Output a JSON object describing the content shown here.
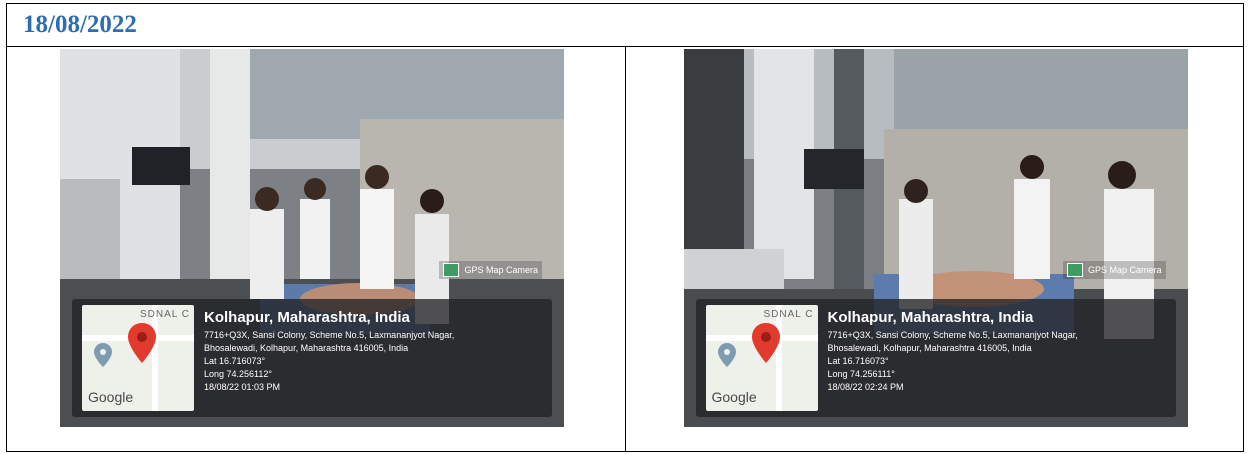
{
  "date": "18/08/2022",
  "photos": [
    {
      "map_label": "SDNAL C",
      "google": "Google",
      "brand": "GPS Map Camera",
      "city": "Kolhapur, Maharashtra, India",
      "address1": "7716+Q3X, Sansi Colony, Scheme No.5, Laxmananjyot Nagar,",
      "address2": "Bhosalewadi, Kolhapur, Maharashtra 416005, India",
      "lat": "Lat 16.716073°",
      "long": "Long 74.256112°",
      "timestamp": "18/08/22 01:03 PM"
    },
    {
      "map_label": "SDNAL C",
      "google": "Google",
      "brand": "GPS Map Camera",
      "city": "Kolhapur, Maharashtra, India",
      "address1": "7716+Q3X, Sansi Colony, Scheme No.5, Laxmananjyot Nagar,",
      "address2": "Bhosalewadi, Kolhapur, Maharashtra 416005, India",
      "lat": "Lat 16.716073°",
      "long": "Long 74.256111°",
      "timestamp": "18/08/22 02:24 PM"
    }
  ]
}
